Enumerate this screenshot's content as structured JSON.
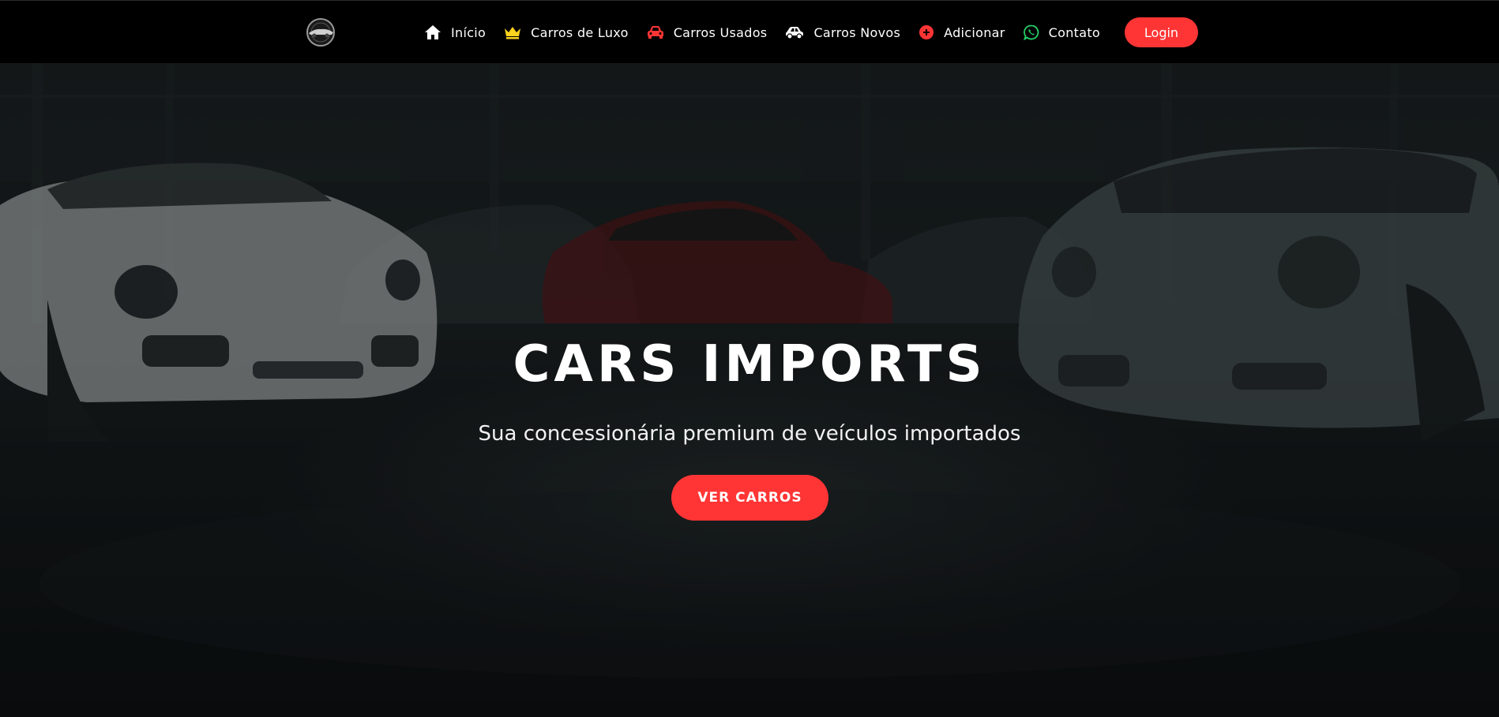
{
  "navbar": {
    "logo_alt": "logo",
    "items": [
      {
        "label": "Início",
        "icon": "home-icon",
        "icon_color": "#ffffff"
      },
      {
        "label": "Carros de Luxo",
        "icon": "crown-icon",
        "icon_color": "#ffd21f"
      },
      {
        "label": "Carros Usados",
        "icon": "car-icon",
        "icon_color": "#ff3535"
      },
      {
        "label": "Carros Novos",
        "icon": "car-side-icon",
        "icon_color": "#ffffff"
      },
      {
        "label": "Adicionar",
        "icon": "plus-circle-icon",
        "icon_color": "#ff3535"
      },
      {
        "label": "Contato",
        "icon": "whatsapp-icon",
        "icon_color": "#25d366"
      }
    ],
    "login_label": "Login"
  },
  "hero": {
    "title": "CARS IMPORTS",
    "subtitle": "Sua concessionária premium de veículos importados",
    "cta_label": "VER CARROS"
  },
  "colors": {
    "accent": "#ff3535",
    "navbar_bg": "#000000",
    "text": "#ffffff"
  }
}
